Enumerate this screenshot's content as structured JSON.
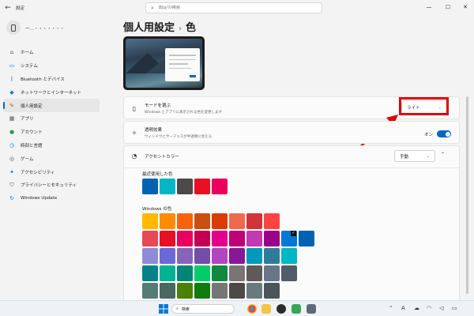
{
  "titlebar": {
    "back_icon": "back-arrow-icon",
    "app_title": "設定",
    "search_placeholder": "設定の検索",
    "minimize": "—",
    "maximize": "☐",
    "close": "✕"
  },
  "user": {
    "name": "ー…・・・・・・・"
  },
  "sidebar": {
    "items": [
      {
        "label": "ホーム",
        "icon": "home-icon",
        "glyph": "⌂",
        "color": "#555555"
      },
      {
        "label": "システム",
        "icon": "monitor-icon",
        "glyph": "▭",
        "color": "#0078d4"
      },
      {
        "label": "Bluetooth とデバイス",
        "icon": "bluetooth-icon",
        "glyph": "ᛒ",
        "color": "#0078d4"
      },
      {
        "label": "ネットワークとインターネット",
        "icon": "wifi-icon",
        "glyph": "◆",
        "color": "#0078d4"
      },
      {
        "label": "個人用設定",
        "icon": "pen-icon",
        "glyph": "✎",
        "color": "#c45a00",
        "active": true
      },
      {
        "label": "アプリ",
        "icon": "apps-icon",
        "glyph": "▦",
        "color": "#555555"
      },
      {
        "label": "アカウント",
        "icon": "account-icon",
        "glyph": "●",
        "color": "#2a9d5c"
      },
      {
        "label": "時刻と言語",
        "icon": "clock-globe-icon",
        "glyph": "◷",
        "color": "#0078d4"
      },
      {
        "label": "ゲーム",
        "icon": "gamepad-icon",
        "glyph": "◎",
        "color": "#555555"
      },
      {
        "label": "アクセシビリティ",
        "icon": "accessibility-icon",
        "glyph": "✦",
        "color": "#0078d4"
      },
      {
        "label": "プライバシーとセキュリティ",
        "icon": "shield-icon",
        "glyph": "⛉",
        "color": "#555555"
      },
      {
        "label": "Windows Update",
        "icon": "update-icon",
        "glyph": "↻",
        "color": "#0078d4"
      }
    ]
  },
  "page": {
    "breadcrumb_parent": "個人用設定",
    "breadcrumb_sep": "›",
    "title": "色"
  },
  "mode": {
    "title": "モードを選ぶ",
    "desc": "Windows とアプリに表示される色を変更します",
    "value": "ライト",
    "icon": "brush-icon"
  },
  "transparency": {
    "title": "透明効果",
    "desc": "ウィンドウとサーフェスが半透明に見える",
    "state": "オン",
    "icon": "transparency-icon"
  },
  "accent": {
    "title": "アクセントカラー",
    "mode_value": "手動",
    "icon": "palette-icon",
    "recent_label": "最近使用した色",
    "recent_colors": [
      "#0063b1",
      "#00b7c3",
      "#4c4a48",
      "#e81123",
      "#ea005e"
    ],
    "windows_label": "Windows の色",
    "windows_colors": [
      [
        "#ffb900",
        "#ff8c00",
        "#f7630c",
        "#ca5010",
        "#da3b01",
        "#ef6950",
        "#d13438",
        "#ff4343"
      ],
      [
        "#e74856",
        "#e81123",
        "#ea005e",
        "#c30052",
        "#e3008c",
        "#bf0077",
        "#c239b3",
        "#9a0089",
        "#0078d4",
        "#0063b1"
      ],
      [
        "#8e8cd8",
        "#6b69d6",
        "#8764b8",
        "#744da9",
        "#b146c2",
        "#881798",
        "#0099bc",
        "#2d7d9a",
        "#00b7c3"
      ],
      [
        "#038387",
        "#00b294",
        "#018574",
        "#00cc6a",
        "#10893e",
        "#7a7574",
        "#5d5a58",
        "#68768a",
        "#515c6b"
      ],
      [
        "#567c73",
        "#486860",
        "#498205",
        "#107c10",
        "#767676",
        "#4c4a48",
        "#69797e",
        "#4a5459"
      ]
    ],
    "selected_color": "#0078d4"
  },
  "taskbar": {
    "search_label": "検索",
    "windows_icon": "windows-start-icon"
  }
}
